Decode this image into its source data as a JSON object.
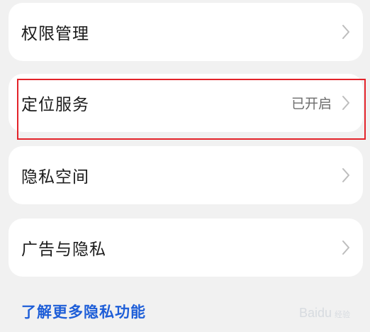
{
  "items": [
    {
      "label": "权限管理",
      "status": ""
    },
    {
      "label": "定位服务",
      "status": "已开启"
    },
    {
      "label": "隐私空间",
      "status": ""
    },
    {
      "label": "广告与隐私",
      "status": ""
    }
  ],
  "more_link": "了解更多隐私功能",
  "watermark": {
    "text": "Baidu",
    "sub": "经验"
  },
  "colors": {
    "background": "#f1f1f1",
    "card": "#ffffff",
    "highlight": "#e3232a",
    "link": "#1e5ed8"
  }
}
